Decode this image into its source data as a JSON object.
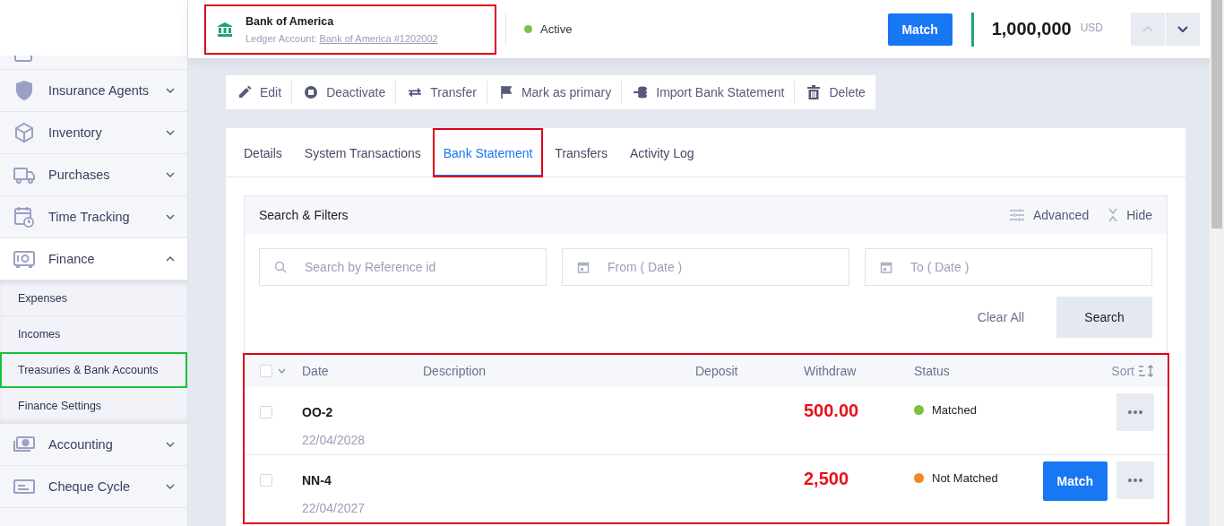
{
  "header": {
    "title": "Bank of America",
    "ledger_label": "Ledger Account:",
    "ledger_link": "Bank of America #1202002",
    "highlighted": true,
    "status": "Active",
    "match_button": "Match",
    "balance": "1,000,000",
    "currency": "USD"
  },
  "sidebar": {
    "items": [
      {
        "label": "Insurance Agents",
        "expanded": false
      },
      {
        "label": "Inventory",
        "expanded": false
      },
      {
        "label": "Purchases",
        "expanded": false
      },
      {
        "label": "Time Tracking",
        "expanded": false
      },
      {
        "label": "Finance",
        "expanded": true,
        "children": [
          {
            "label": "Expenses",
            "highlighted": false
          },
          {
            "label": "Incomes",
            "highlighted": false
          },
          {
            "label": "Treasuries & Bank Accounts",
            "highlighted": true
          },
          {
            "label": "Finance Settings",
            "highlighted": false
          }
        ]
      },
      {
        "label": "Accounting",
        "expanded": false
      },
      {
        "label": "Cheque Cycle",
        "expanded": false
      }
    ]
  },
  "toolbar": [
    "Edit",
    "Deactivate",
    "Transfer",
    "Mark as primary",
    "Import Bank Statement",
    "Delete"
  ],
  "tabs": [
    {
      "label": "Details",
      "selected": false,
      "highlighted": false
    },
    {
      "label": "System Transactions",
      "selected": false,
      "highlighted": false
    },
    {
      "label": "Bank Statement",
      "selected": true,
      "highlighted": true
    },
    {
      "label": "Transfers",
      "selected": false,
      "highlighted": false
    },
    {
      "label": "Activity Log",
      "selected": false,
      "highlighted": false
    }
  ],
  "filters": {
    "title": "Search & Filters",
    "advanced": "Advanced",
    "hide": "Hide",
    "fields": [
      {
        "kind": "search",
        "placeholder": "Search by Reference id"
      },
      {
        "kind": "date",
        "placeholder": "From ( Date )"
      },
      {
        "kind": "date",
        "placeholder": "To ( Date )"
      }
    ],
    "clear": "Clear All",
    "search": "Search"
  },
  "table": {
    "highlighted": true,
    "select_all_checked": false,
    "columns": [
      "Date",
      "Description",
      "Deposit",
      "Withdraw",
      "Status"
    ],
    "sort": "Sort",
    "rows": [
      {
        "checked": false,
        "reference": "OO-2",
        "date": "22/04/2028",
        "withdraw": "500.00",
        "status": "Matched",
        "color": "#7cc242"
      },
      {
        "checked": false,
        "reference": "NN-4",
        "date": "22/04/2027",
        "withdraw": "2,500",
        "status": "Not Matched",
        "color": "#f08a24",
        "action": "Match"
      }
    ]
  }
}
